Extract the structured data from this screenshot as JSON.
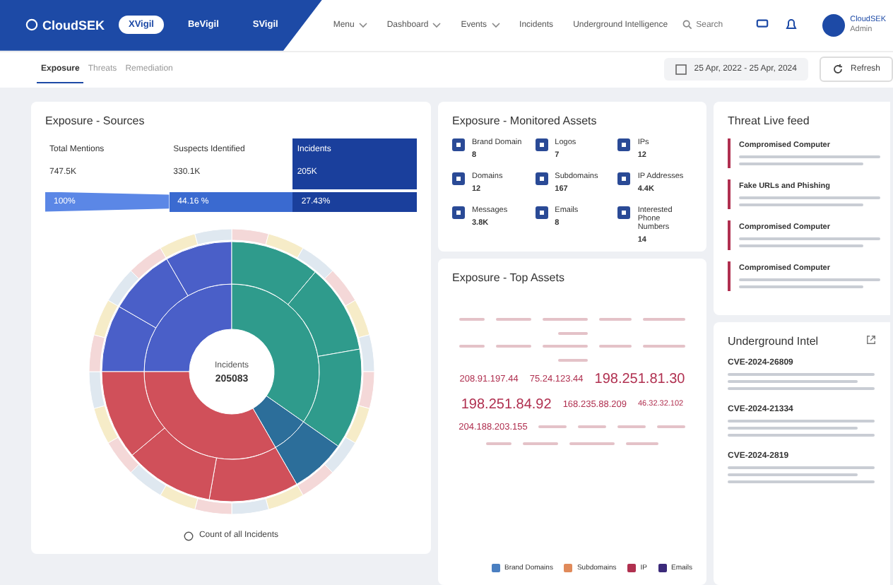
{
  "nav": {
    "logo": "CloudSEK",
    "products": [
      {
        "label": "XVigil",
        "selected": true
      },
      {
        "label": "BeVigil",
        "selected": false
      },
      {
        "label": "SVigil",
        "selected": false
      }
    ],
    "menu": [
      {
        "label": "Menu",
        "dropdown": true
      },
      {
        "label": "Dashboard",
        "dropdown": true
      },
      {
        "label": "Events",
        "dropdown": true
      },
      {
        "label": "Incidents",
        "dropdown": false
      },
      {
        "label": "Underground Intelligence",
        "dropdown": false
      }
    ],
    "search": {
      "placeholder": "Search"
    },
    "user": {
      "name": "CloudSEK",
      "role": "Admin"
    }
  },
  "subnav": {
    "tabs": [
      {
        "label": "Exposure",
        "selected": true
      },
      {
        "label": "Threats",
        "selected": false
      },
      {
        "label": "Remediation",
        "selected": false
      }
    ],
    "date_range": "25 Apr, 2022 - 25 Apr, 2024",
    "refresh": "Refresh"
  },
  "sources": {
    "title": "Exposure - Sources",
    "stats": [
      {
        "label": "Total Mentions",
        "value": "747.5K",
        "share": "100%",
        "selected": false
      },
      {
        "label": "Suspects Identified",
        "value": "330.1K",
        "share": "44.16 %",
        "selected": false
      },
      {
        "label": "Incidents",
        "value": "205K",
        "share": "27.43%",
        "selected": true
      }
    ],
    "center_label": "Incidents",
    "center_value": "205083",
    "footer": "Count of all Incidents"
  },
  "assets": {
    "title": "Exposure - Monitored Assets",
    "items": [
      {
        "label": "Brand Domain",
        "value": "8"
      },
      {
        "label": "Logos",
        "value": "7"
      },
      {
        "label": "IPs",
        "value": "12"
      },
      {
        "label": "Domains",
        "value": "12"
      },
      {
        "label": "Subdomains",
        "value": "167"
      },
      {
        "label": "IP Addresses",
        "value": "4.4K"
      },
      {
        "label": "Messages",
        "value": "3.8K"
      },
      {
        "label": "Emails",
        "value": "8"
      },
      {
        "label": "Interested Phone Numbers",
        "value": "14"
      }
    ]
  },
  "top_assets": {
    "title": "Exposure - Top Assets",
    "words": [
      {
        "text": "208.91.197.44",
        "kind": "medium"
      },
      {
        "text": "75.24.123.44",
        "kind": "medium"
      },
      {
        "text": "198.251.81.30",
        "kind": "large"
      },
      {
        "text": "198.251.84.92",
        "kind": "large"
      },
      {
        "text": "168.235.88.209",
        "kind": "medium"
      },
      {
        "text": "46.32.32.102",
        "kind": "small"
      },
      {
        "text": "204.188.203.155",
        "kind": "medium"
      }
    ],
    "legend": [
      {
        "label": "Brand Domains",
        "color": "#4a7fc1"
      },
      {
        "label": "Subdomains",
        "color": "#e08a5a"
      },
      {
        "label": "IP",
        "color": "#b0304f"
      },
      {
        "label": "Emails",
        "color": "#3b2a7a"
      }
    ]
  },
  "feed": {
    "title": "Threat Live feed",
    "items": [
      {
        "title": "Compromised Computer"
      },
      {
        "title": "Fake URLs and Phishing"
      },
      {
        "title": "Compromised Computer"
      },
      {
        "title": "Compromised Computer"
      }
    ]
  },
  "intel": {
    "title": "Underground Intel",
    "items": [
      {
        "title": "CVE-2024-26809"
      },
      {
        "title": "CVE-2024-21334"
      },
      {
        "title": "CVE-2024-2819"
      }
    ]
  }
}
